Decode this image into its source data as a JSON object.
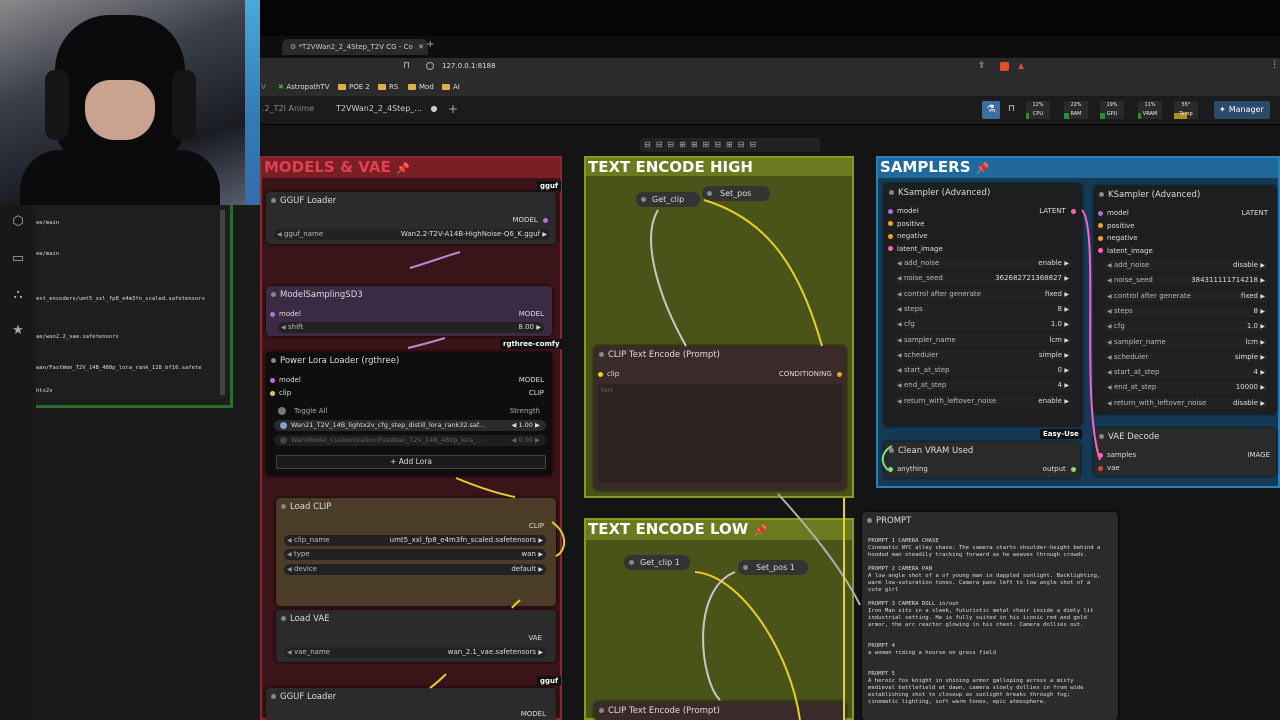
{
  "browser": {
    "tab_title": "*T2VWan2_2_4Step_T2V CG - Co",
    "url": "127.0.0.1:8188",
    "bookmarks": [
      "AstropathTV",
      "POE 2",
      "RS",
      "Mod",
      "AI"
    ],
    "bookmark_leading": "V"
  },
  "comfy": {
    "tabs": [
      ".2_T2I Anime",
      "T2VWan2_2_4Step_..."
    ],
    "meters": [
      {
        "label": "CPU",
        "value": "12%",
        "fraction": 0.12
      },
      {
        "label": "RAM",
        "value": "22%",
        "fraction": 0.22
      },
      {
        "label": "GPU",
        "value": "19%",
        "fraction": 0.19
      },
      {
        "label": "VRAM",
        "value": "11%",
        "fraction": 0.11
      },
      {
        "label": "Temp",
        "value": "55°",
        "fraction": 0.55
      }
    ],
    "manager_label": "Manager"
  },
  "file_list": [
    "ee/main",
    "ee/main",
    "ext_encoders/umt5_xxl_fp8_e4m3fn_scaled.safetensors",
    "ae/wan2.2_vae.safetensors",
    "wan/FastWan_T2V_14B_480p_lora_rank_128_bf16.safete",
    "htx2v"
  ],
  "groups": {
    "models": "MODELS & VAE",
    "text_high": "TEXT ENCODE HIGH",
    "samplers": "SAMPLERS",
    "text_low": "TEXT ENCODE LOW"
  },
  "gguf_loader": {
    "title": "GGUF Loader",
    "badge": "gguf",
    "out": "MODEL",
    "widget_name": "gguf_name",
    "widget_value": "Wan2.2-T2V-A14B-HighNoise-Q6_K.gguf"
  },
  "model_sampling": {
    "title": "ModelSamplingSD3",
    "in": "model",
    "out": "MODEL",
    "widget_name": "shift",
    "widget_value": "8.00",
    "badge": "rgthree-comfy"
  },
  "power_lora": {
    "title": "Power Lora Loader (rgthree)",
    "in_model": "model",
    "in_clip": "clip",
    "out_model": "MODEL",
    "out_clip": "CLIP",
    "toggle_all": "Toggle All",
    "strength_label": "Strength",
    "lora1": "Wan21_T2V_14B_lightx2v_cfg_step_distill_lora_rank32.saf...",
    "lora1_strength": "1.00",
    "lora2": "Wan\\Model_Customization\\FastWan_T2V_14B_480p_lora_...",
    "lora2_strength": "0.00",
    "add_lora": "+ Add Lora"
  },
  "load_clip": {
    "title": "Load CLIP",
    "out": "CLIP",
    "widgets": [
      {
        "name": "clip_name",
        "value": "umt5_xxl_fp8_e4m3fn_scaled.safetensors"
      },
      {
        "name": "type",
        "value": "wan"
      },
      {
        "name": "device",
        "value": "default"
      }
    ]
  },
  "load_vae": {
    "title": "Load VAE",
    "out": "VAE",
    "widget_name": "vae_name",
    "widget_value": "wan_2.1_vae.safetensors",
    "badge": "gguf"
  },
  "gguf_loader2": {
    "title": "GGUF Loader",
    "out": "MODEL"
  },
  "high": {
    "get_clip": "Get_clip",
    "set_pos": "Set_pos",
    "clip_encode": {
      "title": "CLIP Text Encode (Prompt)",
      "in": "clip",
      "out": "CONDITIONING",
      "placeholder": "text"
    }
  },
  "low": {
    "get_clip": "Get_clip 1",
    "set_pos": "Set_pos 1",
    "clip_encode_title": "CLIP Text Encode (Prompt)"
  },
  "ksampler1": {
    "title": "KSampler (Advanced)",
    "out": "LATENT",
    "inputs": [
      "model",
      "positive",
      "negative",
      "latent_image"
    ],
    "widgets": [
      {
        "name": "add_noise",
        "value": "enable"
      },
      {
        "name": "noise_seed",
        "value": "362682721368827"
      },
      {
        "name": "control after generate",
        "value": "fixed"
      },
      {
        "name": "steps",
        "value": "8"
      },
      {
        "name": "cfg",
        "value": "1.0"
      },
      {
        "name": "sampler_name",
        "value": "lcm"
      },
      {
        "name": "scheduler",
        "value": "simple"
      },
      {
        "name": "start_at_step",
        "value": "0"
      },
      {
        "name": "end_at_step",
        "value": "4"
      },
      {
        "name": "return_with_leftover_noise",
        "value": "enable"
      }
    ]
  },
  "ksampler2": {
    "title": "KSampler (Advanced)",
    "out": "LATENT",
    "inputs": [
      "model",
      "positive",
      "negative",
      "latent_image"
    ],
    "widgets": [
      {
        "name": "add_noise",
        "value": "disable"
      },
      {
        "name": "noise_seed",
        "value": "384311111714218"
      },
      {
        "name": "control after generate",
        "value": "fixed"
      },
      {
        "name": "steps",
        "value": "8"
      },
      {
        "name": "cfg",
        "value": "1.0"
      },
      {
        "name": "sampler_name",
        "value": "lcm"
      },
      {
        "name": "scheduler",
        "value": "simple"
      },
      {
        "name": "start_at_step",
        "value": "4"
      },
      {
        "name": "end_at_step",
        "value": "10000"
      },
      {
        "name": "return_with_leftover_noise",
        "value": "disable"
      }
    ]
  },
  "easy_use": "Easy-Use",
  "clean_vram": {
    "title": "Clean VRAM Used",
    "in": "anything",
    "out": "output"
  },
  "vae_decode": {
    "title": "VAE Decode",
    "in1": "samples",
    "in2": "vae",
    "out": "IMAGE"
  },
  "prompt_note": {
    "title": "PROMPT",
    "lines": [
      "PROMPT 1 CAMERA CHASE",
      "Cinematic NYC alley chase: The camera starts shoulder-height behind a",
      "hooded man steadily tracking forward as he weaves through crowds.",
      "",
      "PROMPT 2 CAMERA PAN",
      "A low angle shot of a of young man in dappled sunlight. Backlighting,",
      "warm low-saturation tones. Camera pans left to low angle shot of a",
      "cute girl",
      "",
      "PROMPT 3 CAMERA DOLL in/out",
      "Iron Man sits in a sleek, futuristic metal chair inside a dimly lit",
      "industrial setting. He is fully suited in his iconic red and gold",
      "armor, the arc reactor glowing in his chest. Camera dollies out.",
      "",
      "",
      "PROMPT 4",
      "a woman riding a hourse on grass field",
      "",
      "",
      "PROMPT 5",
      "A heroic fox knight in shining armor galloping across a misty",
      "medieval battlefield at dawn, camera slowly dollies in from wide",
      "establishing shot to closeup as sunlight breaks through fog;",
      "cinematic lighting, soft warm tones, epic atmosphere."
    ]
  },
  "colors": {
    "models_group": "#7a1f25",
    "text_group": "#6b7a1f",
    "samplers_group": "#1f6a9a",
    "accent_yellow": "#e6d020"
  }
}
